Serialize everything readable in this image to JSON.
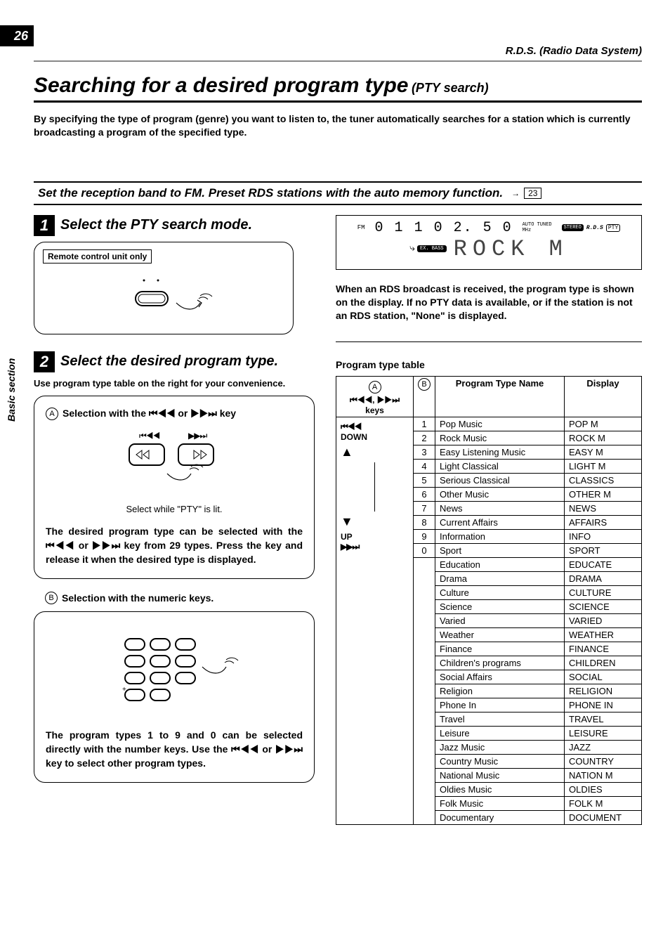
{
  "page_number": "26",
  "header_section": "R.D.S. (Radio Data System)",
  "side_tab": "Basic section",
  "title_main": "Searching for a desired program type",
  "title_sub": "(PTY search)",
  "intro": "By specifying the type of program (genre) you want to listen to, the tuner automatically searches for a station which is currently broadcasting a program of the specified type.",
  "preset_bar": "Set the reception band to FM.  Preset RDS stations with the auto memory function.",
  "page_ref": "23",
  "step1": {
    "num": "1",
    "title": "Select the PTY search mode.",
    "remote_label": "Remote control unit only"
  },
  "step2": {
    "num": "2",
    "title": "Select the desired program type.",
    "note": "Use program type table on the right for your convenience."
  },
  "selA": {
    "letter": "A",
    "head": "Selection with the ⏮◀◀ or ▶▶⏭ key",
    "caption": "Select while \"PTY\" is lit.",
    "body": "The desired program type can be selected with the ⏮◀◀ or ▶▶⏭ key from 29 types. Press the key and release it when the desired type is displayed."
  },
  "selB": {
    "letter": "B",
    "head": "Selection with the numeric keys.",
    "body": "The program types 1 to 9 and 0 can be selected directly with the number keys. Use the ⏮◀◀ or ▶▶⏭ key to select other program types."
  },
  "display": {
    "fm": "FM",
    "preset": "0 1",
    "freq": "1 0 2. 5 0",
    "auto_tuned": "AUTO TUNED",
    "mhz": "MHz",
    "stereo": "STEREO",
    "rds": "R.D.S",
    "pty": "PTY",
    "exbass": "EX. BASS",
    "text": "ROCK M"
  },
  "right_note": "When an RDS broadcast is received, the program type is shown on the display. If no PTY data is available, or if the station is not an RDS station, \"None\" is displayed.",
  "table": {
    "title": "Program type table",
    "head_keys_a": "A",
    "head_keys": "⏮◀◀, ▶▶⏭ keys",
    "head_b": "B",
    "head_name": "Program Type Name",
    "head_display": "Display",
    "keys_down": "DOWN",
    "keys_up": "UP",
    "rows": [
      {
        "n": "1",
        "name": "Pop Music",
        "disp": "POP M"
      },
      {
        "n": "2",
        "name": "Rock Music",
        "disp": "ROCK M"
      },
      {
        "n": "3",
        "name": "Easy Listening Music",
        "disp": "EASY M"
      },
      {
        "n": "4",
        "name": "Light Classical",
        "disp": "LIGHT M"
      },
      {
        "n": "5",
        "name": "Serious Classical",
        "disp": "CLASSICS"
      },
      {
        "n": "6",
        "name": "Other Music",
        "disp": "OTHER M"
      },
      {
        "n": "7",
        "name": "News",
        "disp": "NEWS"
      },
      {
        "n": "8",
        "name": "Current Affairs",
        "disp": "AFFAIRS"
      },
      {
        "n": "9",
        "name": "Information",
        "disp": "INFO"
      },
      {
        "n": "0",
        "name": "Sport",
        "disp": "SPORT"
      },
      {
        "n": "",
        "name": "Education",
        "disp": "EDUCATE"
      },
      {
        "n": "",
        "name": "Drama",
        "disp": "DRAMA"
      },
      {
        "n": "",
        "name": "Culture",
        "disp": "CULTURE"
      },
      {
        "n": "",
        "name": "Science",
        "disp": "SCIENCE"
      },
      {
        "n": "",
        "name": "Varied",
        "disp": "VARIED"
      },
      {
        "n": "",
        "name": "Weather",
        "disp": "WEATHER"
      },
      {
        "n": "",
        "name": "Finance",
        "disp": "FINANCE"
      },
      {
        "n": "",
        "name": "Children's programs",
        "disp": "CHILDREN"
      },
      {
        "n": "",
        "name": "Social Affairs",
        "disp": "SOCIAL"
      },
      {
        "n": "",
        "name": "Religion",
        "disp": "RELIGION"
      },
      {
        "n": "",
        "name": "Phone In",
        "disp": "PHONE IN"
      },
      {
        "n": "",
        "name": "Travel",
        "disp": "TRAVEL"
      },
      {
        "n": "",
        "name": "Leisure",
        "disp": "LEISURE"
      },
      {
        "n": "",
        "name": "Jazz Music",
        "disp": "JAZZ"
      },
      {
        "n": "",
        "name": "Country Music",
        "disp": "COUNTRY"
      },
      {
        "n": "",
        "name": "National Music",
        "disp": "NATION M"
      },
      {
        "n": "",
        "name": "Oldies Music",
        "disp": "OLDIES"
      },
      {
        "n": "",
        "name": "Folk Music",
        "disp": "FOLK M"
      },
      {
        "n": "",
        "name": "Documentary",
        "disp": "DOCUMENT"
      }
    ]
  }
}
